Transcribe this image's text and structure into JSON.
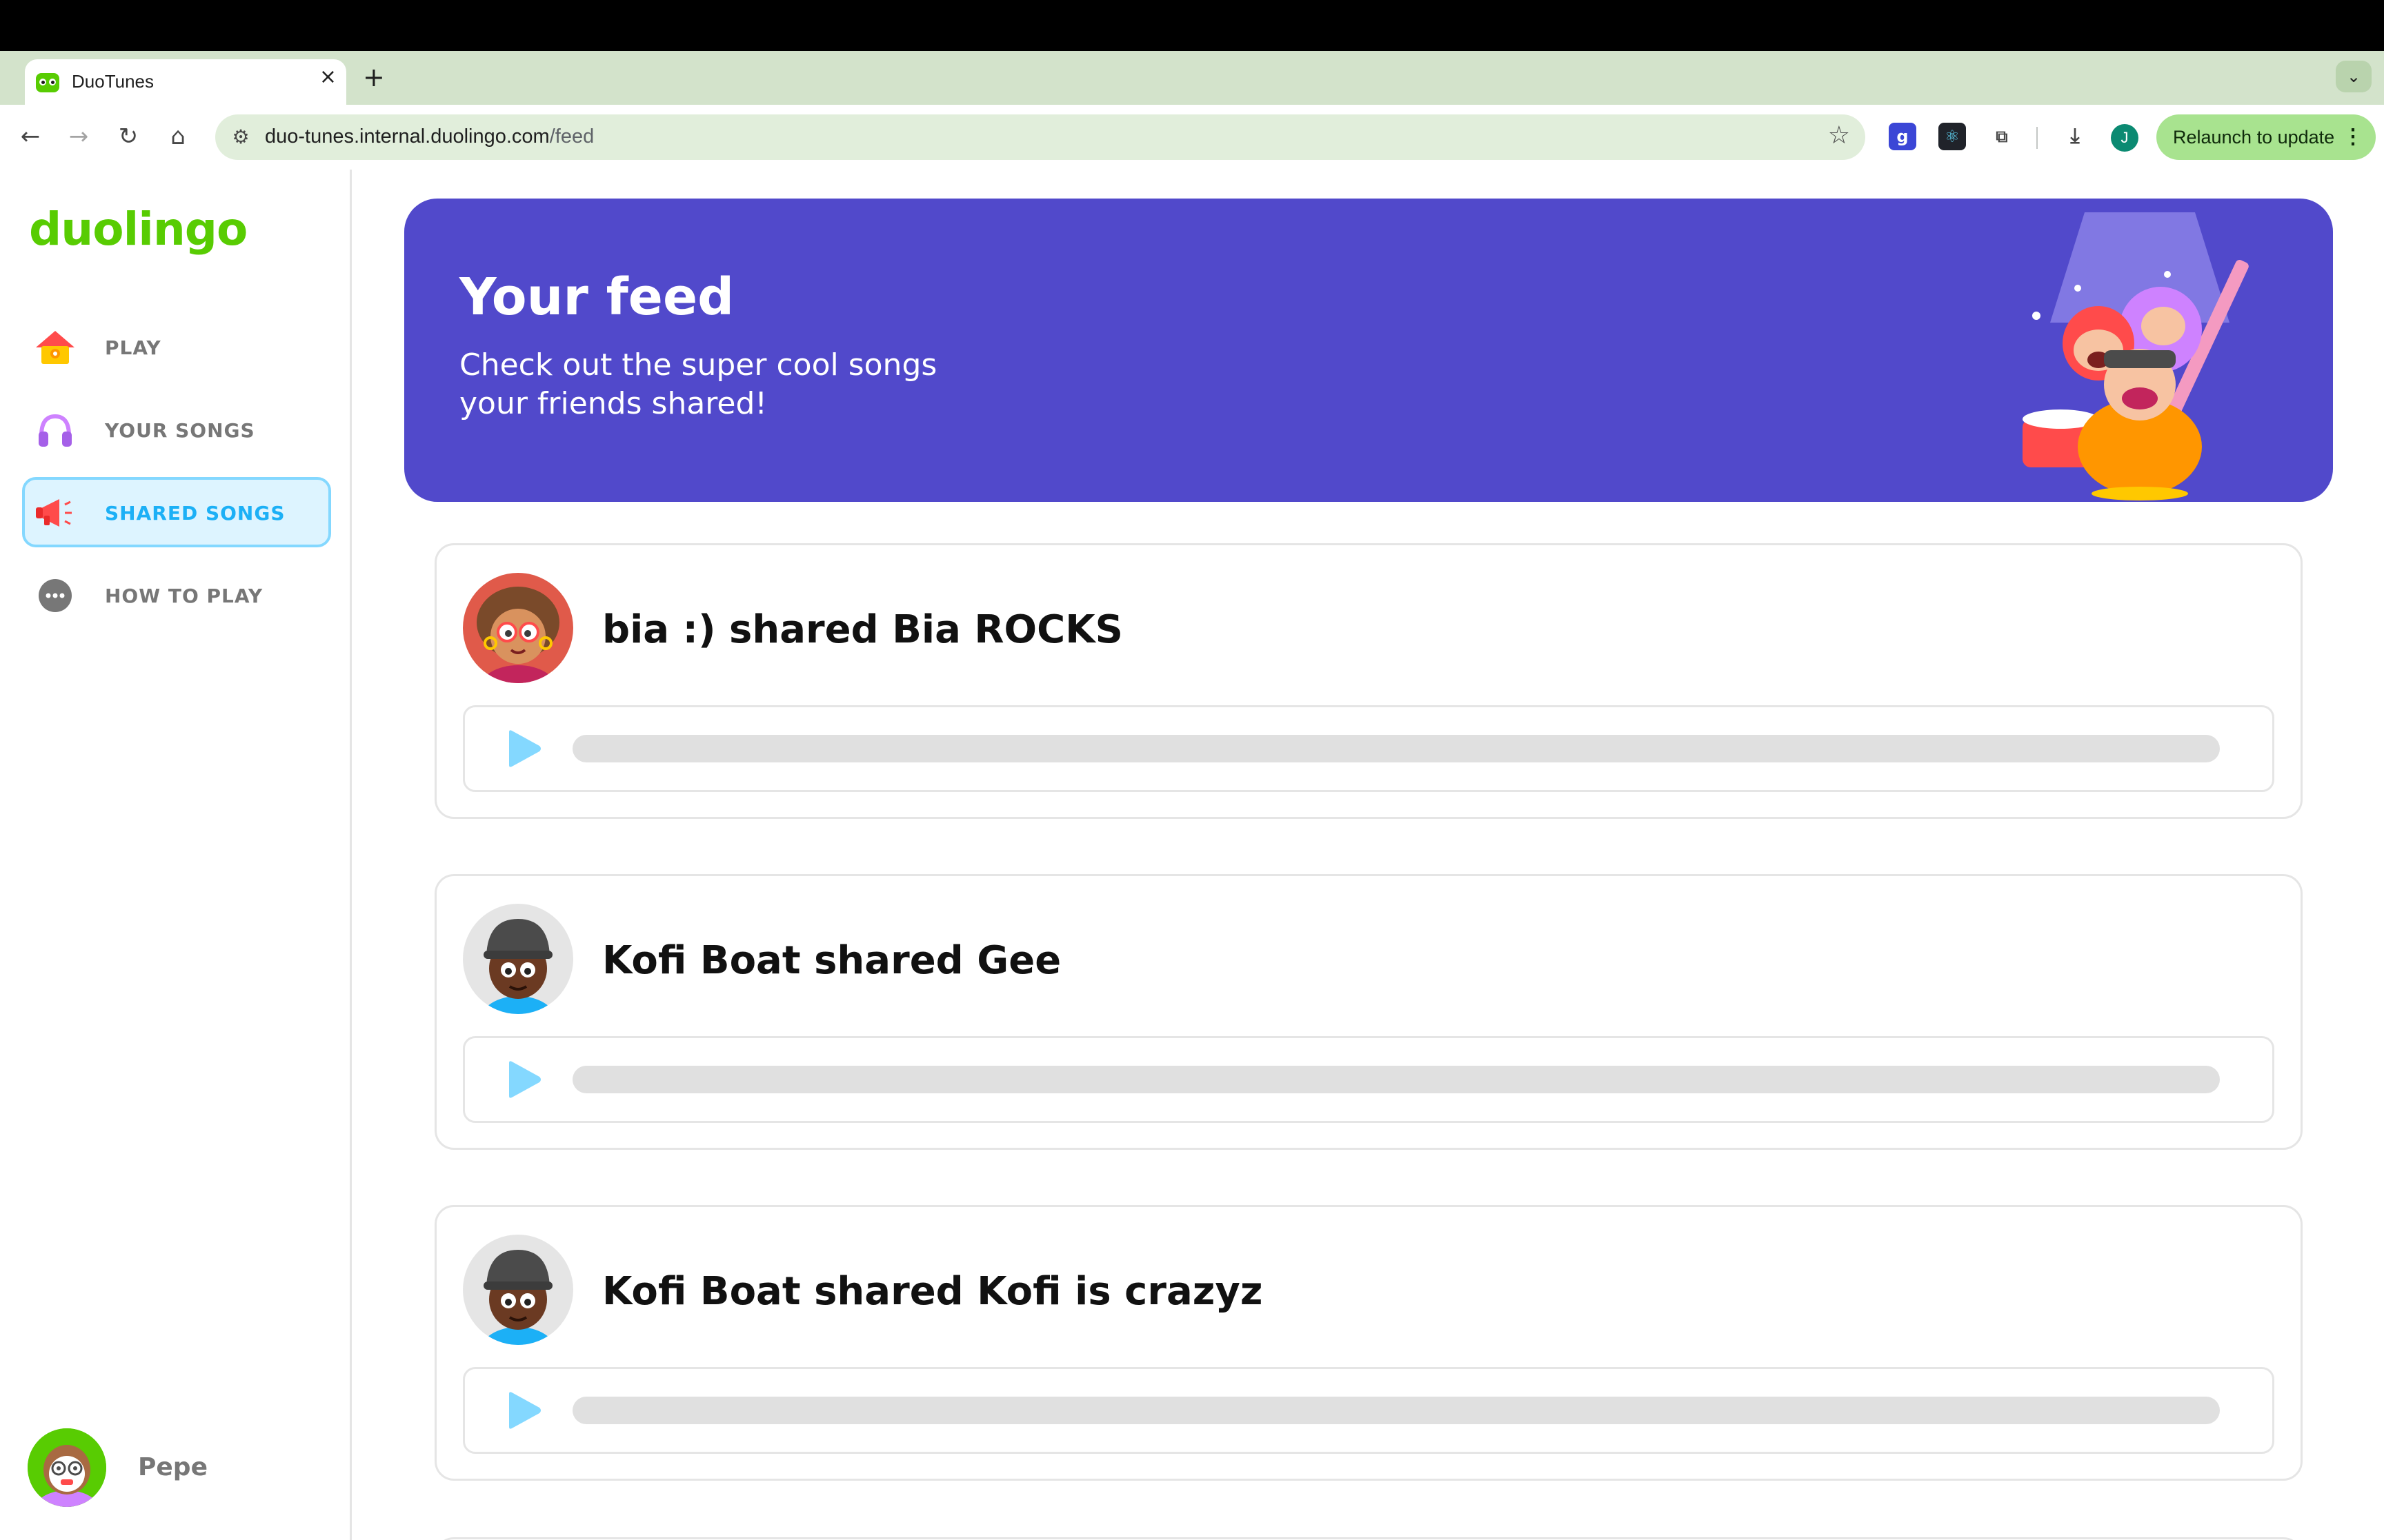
{
  "browser": {
    "tab_title": "DuoTunes",
    "tab_close": "×",
    "new_tab": "+",
    "url_host": "duo-tunes.internal.duolingo.com",
    "url_path": "/feed",
    "profile_initial": "J",
    "relaunch_label": "Relaunch to update"
  },
  "sidebar": {
    "logo": "duolingo",
    "items": [
      {
        "label": "PLAY",
        "icon": "house-icon"
      },
      {
        "label": "YOUR SONGS",
        "icon": "headphones-icon"
      },
      {
        "label": "SHARED SONGS",
        "icon": "megaphone-icon",
        "active": true
      },
      {
        "label": "HOW TO PLAY",
        "icon": "more-dots-icon"
      }
    ],
    "user_name": "Pepe"
  },
  "banner": {
    "title": "Your feed",
    "subtitle": "Check out the super cool songs your friends shared!"
  },
  "feed": [
    {
      "title": "bia :) shared Bia ROCKS",
      "progress": 0
    },
    {
      "title": "Kofi Boat shared Gee",
      "progress": 0
    },
    {
      "title": "Kofi Boat shared Kofi is crazyz",
      "progress": 0
    }
  ],
  "colors": {
    "brand_green": "#58cc02",
    "banner_purple": "#5149cb",
    "active_blue": "#1cb0f6",
    "play_blue": "#84d8ff"
  }
}
